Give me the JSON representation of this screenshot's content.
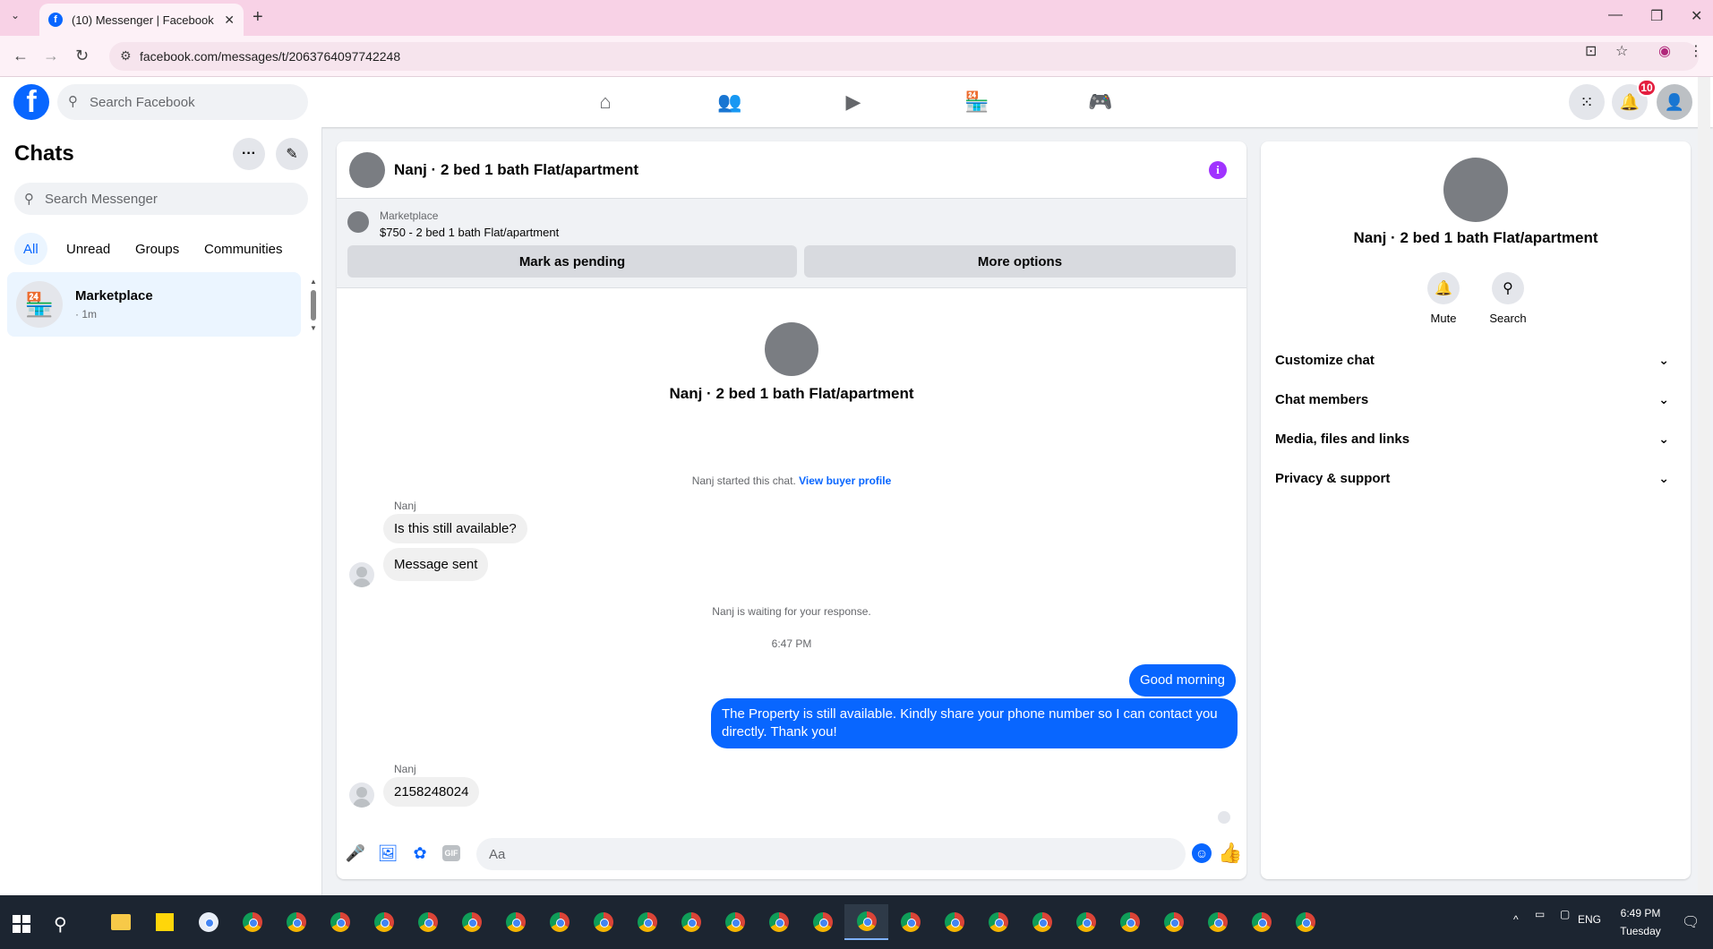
{
  "browser": {
    "tab_title": "(10) Messenger | Facebook",
    "url": "facebook.com/messages/t/2063764097742248"
  },
  "fb": {
    "search_placeholder": "Search Facebook",
    "notifications_count": "10"
  },
  "sidebar": {
    "title": "Chats",
    "search_placeholder": "Search Messenger",
    "filters": [
      "All",
      "Unread",
      "Groups",
      "Communities"
    ],
    "chats": [
      {
        "name": "Marketplace",
        "time": "· 1m"
      }
    ]
  },
  "conversation": {
    "title": "Nanj · 2 bed 1 bath Flat/apartment",
    "marketplace_label": "Marketplace",
    "listing": "$750 - 2 bed 1 bath Flat/apartment",
    "mark_pending": "Mark as pending",
    "more_options": "More options",
    "center_name": "Nanj · 2 bed 1 bath Flat/apartment",
    "started_text": "Nanj started this chat.",
    "view_profile": "View buyer profile",
    "sender": "Nanj",
    "msg1": "Is this still available?",
    "msg2": "Message sent",
    "waiting": "Nanj is waiting for your response.",
    "time": "6:47 PM",
    "out1": "Good morning",
    "out2": "The Property is still available. Kindly share your phone number so I can contact you directly. Thank you!",
    "sender2": "Nanj",
    "msg3": "2158248024",
    "composer_placeholder": "Aa",
    "gif_label": "GIF"
  },
  "right_panel": {
    "name": "Nanj · 2 bed 1 bath Flat/apartment",
    "mute": "Mute",
    "search": "Search",
    "sections": [
      "Customize chat",
      "Chat members",
      "Media, files and links",
      "Privacy & support"
    ]
  },
  "taskbar": {
    "time": "6:49 PM",
    "day": "Tuesday",
    "lang": "ENG"
  }
}
